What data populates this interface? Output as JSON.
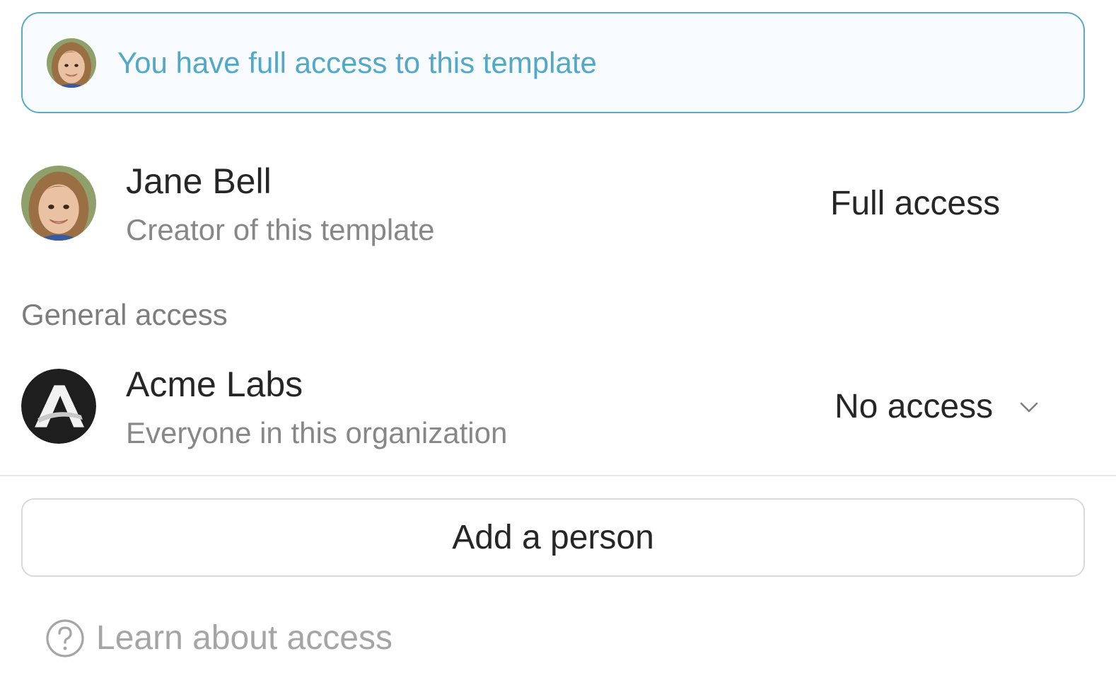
{
  "banner": {
    "avatar_icon": "user-avatar-photo",
    "text": "You have full access to this template",
    "accent_color": "#52a8c6"
  },
  "creator": {
    "avatar_icon": "user-avatar-photo",
    "name": "Jane Bell",
    "subtitle": "Creator of this template",
    "access_level": "Full access"
  },
  "general_access": {
    "section_label": "General access",
    "org_icon": "acme-labs-logo",
    "logo_letter": "A",
    "name": "Acme Labs",
    "subtitle": "Everyone in this organization",
    "access_level": "No access",
    "dropdown_icon": "chevron-down-icon"
  },
  "add_button_label": "Add a person",
  "learn_link": {
    "icon": "help-circle-icon",
    "label": "Learn about access"
  }
}
